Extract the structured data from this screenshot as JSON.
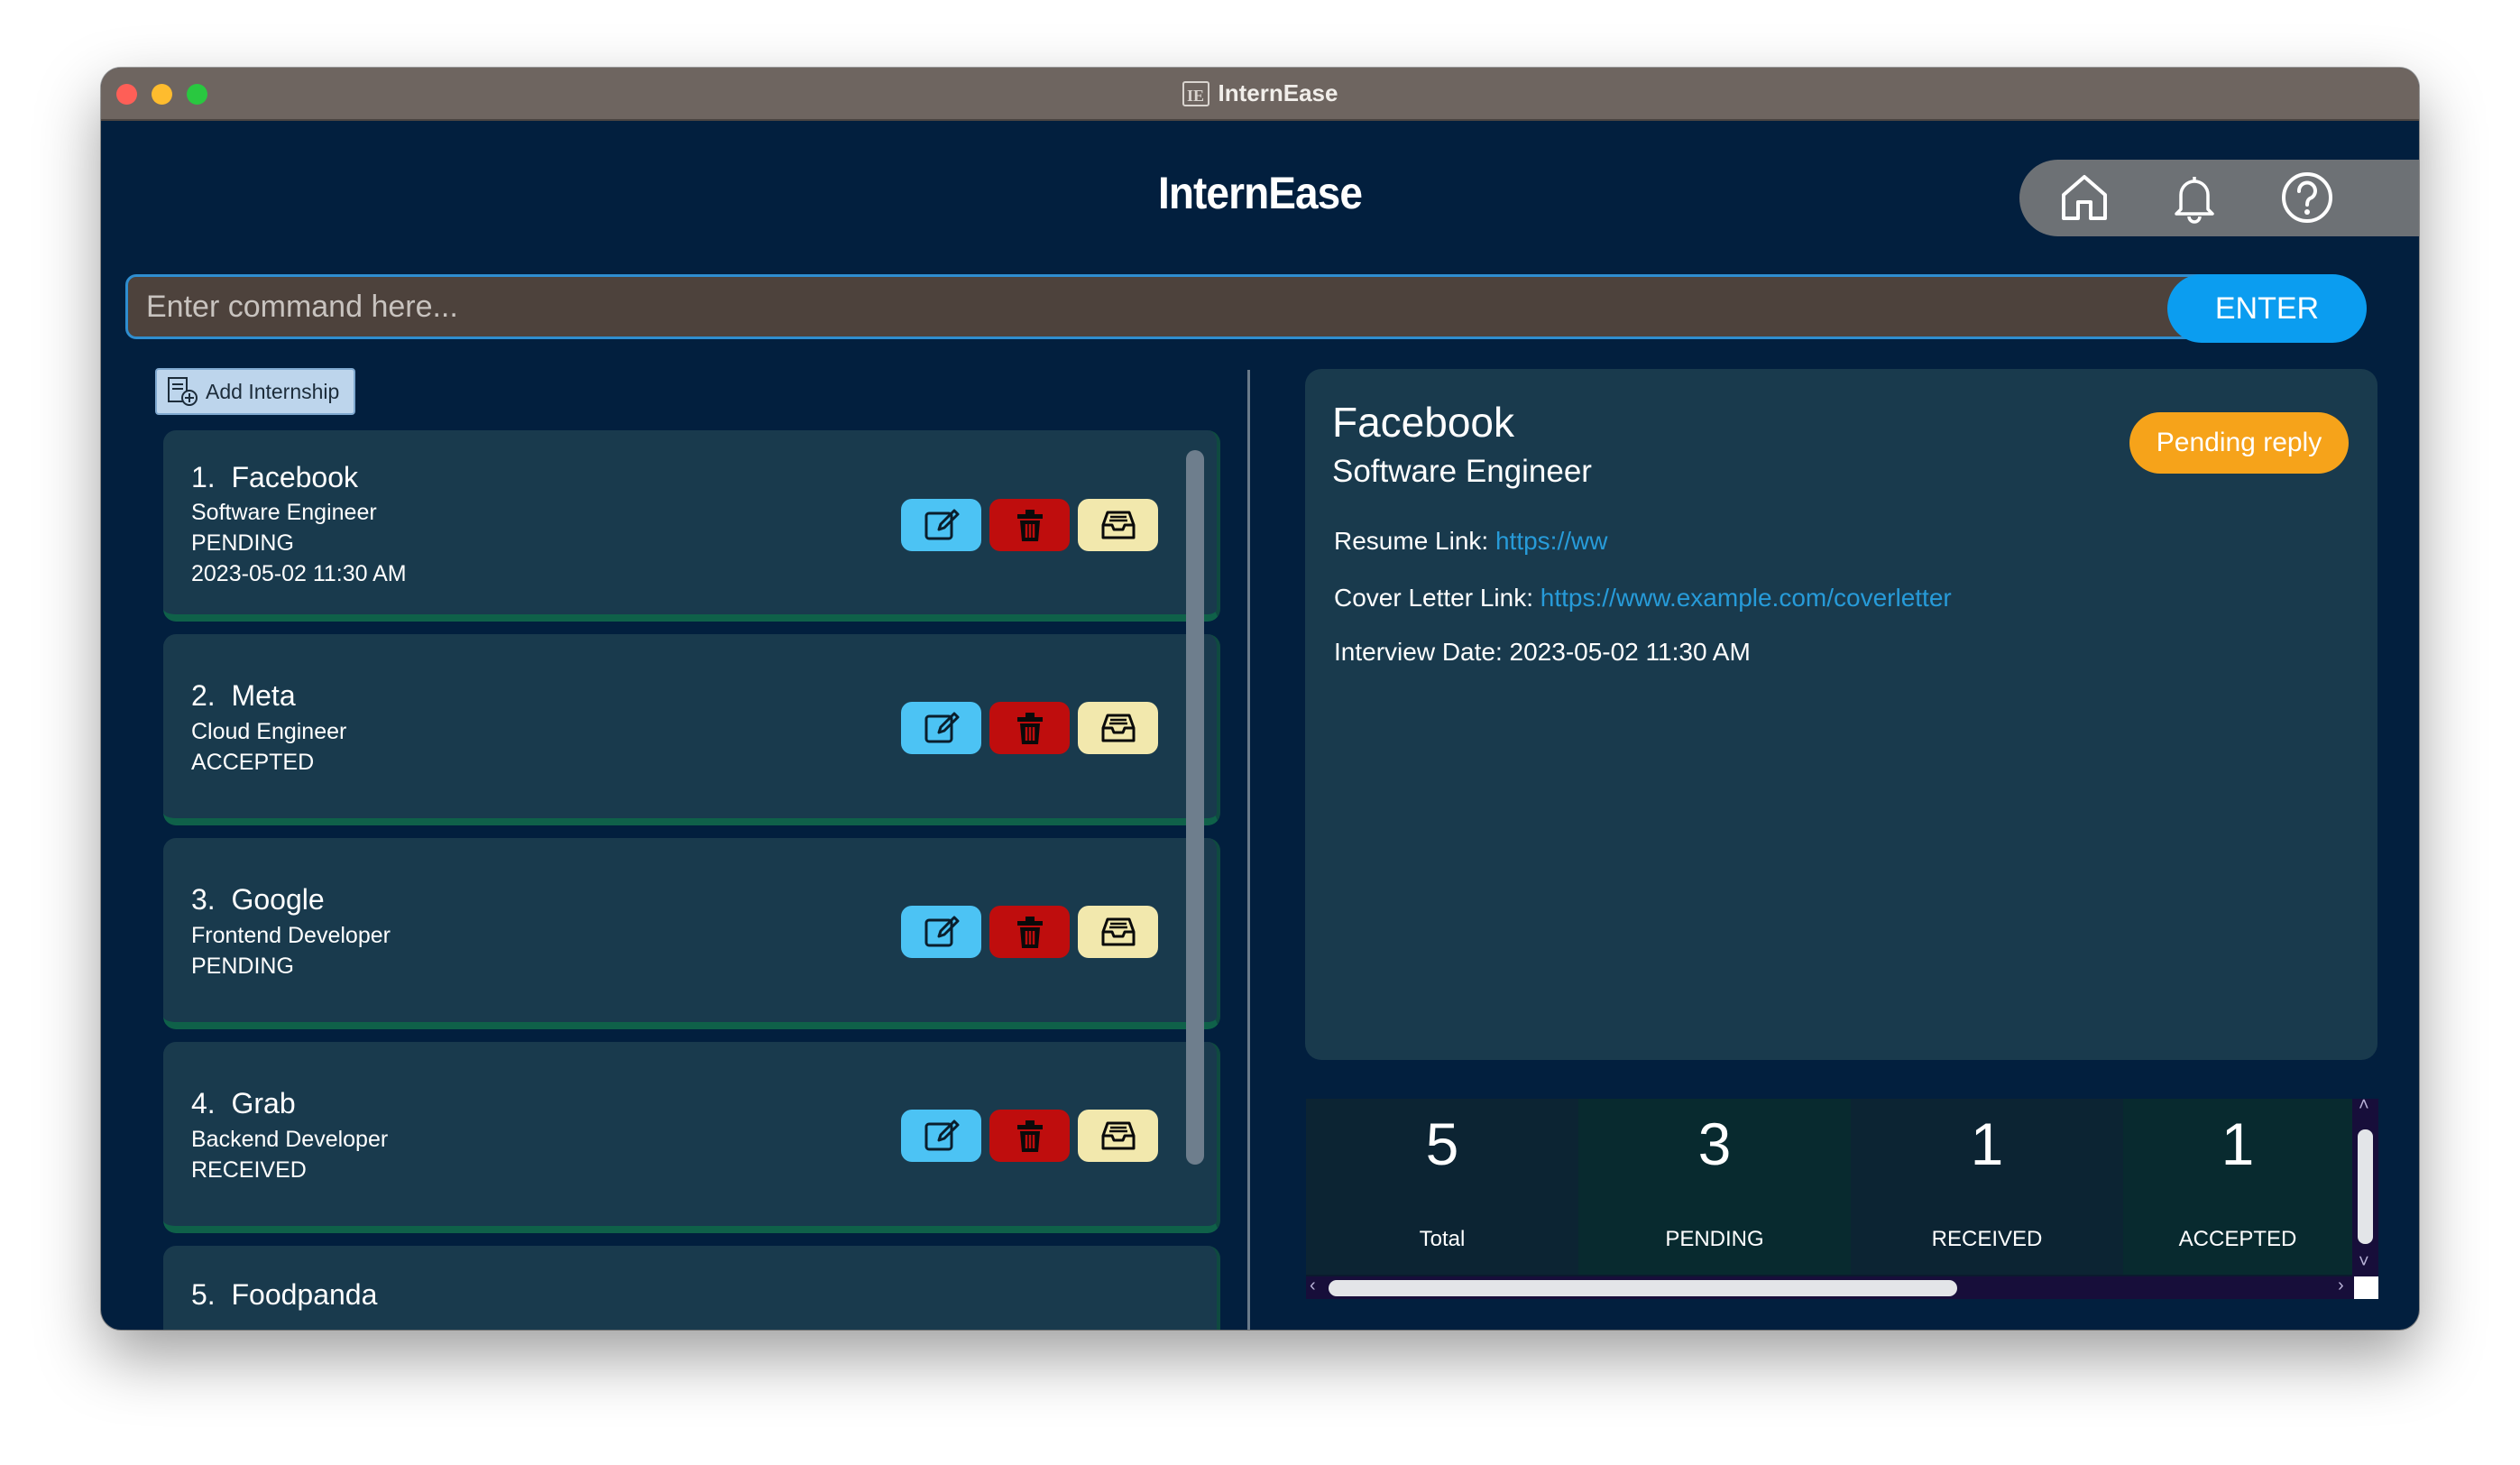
{
  "window": {
    "title": "InternEase"
  },
  "header": {
    "title": "InternEase"
  },
  "nav": {
    "icons": [
      "home-icon",
      "bell-icon",
      "help-icon"
    ]
  },
  "command": {
    "placeholder": "Enter command here...",
    "enter_label": "ENTER"
  },
  "list": {
    "add_label": "Add Internship",
    "items": [
      {
        "index": "1.",
        "company": "Facebook",
        "role": "Software Engineer",
        "status": "PENDING",
        "date": "2023-05-02 11:30 AM"
      },
      {
        "index": "2.",
        "company": "Meta",
        "role": "Cloud Engineer",
        "status": "ACCEPTED",
        "date": ""
      },
      {
        "index": "3.",
        "company": "Google",
        "role": "Frontend Developer",
        "status": "PENDING",
        "date": ""
      },
      {
        "index": "4.",
        "company": "Grab",
        "role": "Backend Developer",
        "status": "RECEIVED",
        "date": ""
      },
      {
        "index": "5.",
        "company": "Foodpanda",
        "role": "",
        "status": "",
        "date": ""
      }
    ]
  },
  "detail": {
    "company": "Facebook",
    "role": "Software Engineer",
    "badge": "Pending reply",
    "badge_color": "#f6a31a",
    "resume_label": "Resume Link:",
    "resume_link": "https://ww",
    "cover_label": "Cover Letter Link:",
    "cover_link": "https://www.example.com/coverletter",
    "interview_label": "Interview Date:",
    "interview_date": "2023-05-02 11:30 AM"
  },
  "stats": [
    {
      "value": "5",
      "label": "Total"
    },
    {
      "value": "3",
      "label": "PENDING"
    },
    {
      "value": "1",
      "label": "RECEIVED"
    },
    {
      "value": "1",
      "label": "ACCEPTED"
    }
  ],
  "colors": {
    "background": "#021f3e",
    "card": "#193a4d",
    "accent": "#0b9df0",
    "edit": "#4cc3f4",
    "delete": "#bf0d0d",
    "archive": "#f2e8ad"
  }
}
